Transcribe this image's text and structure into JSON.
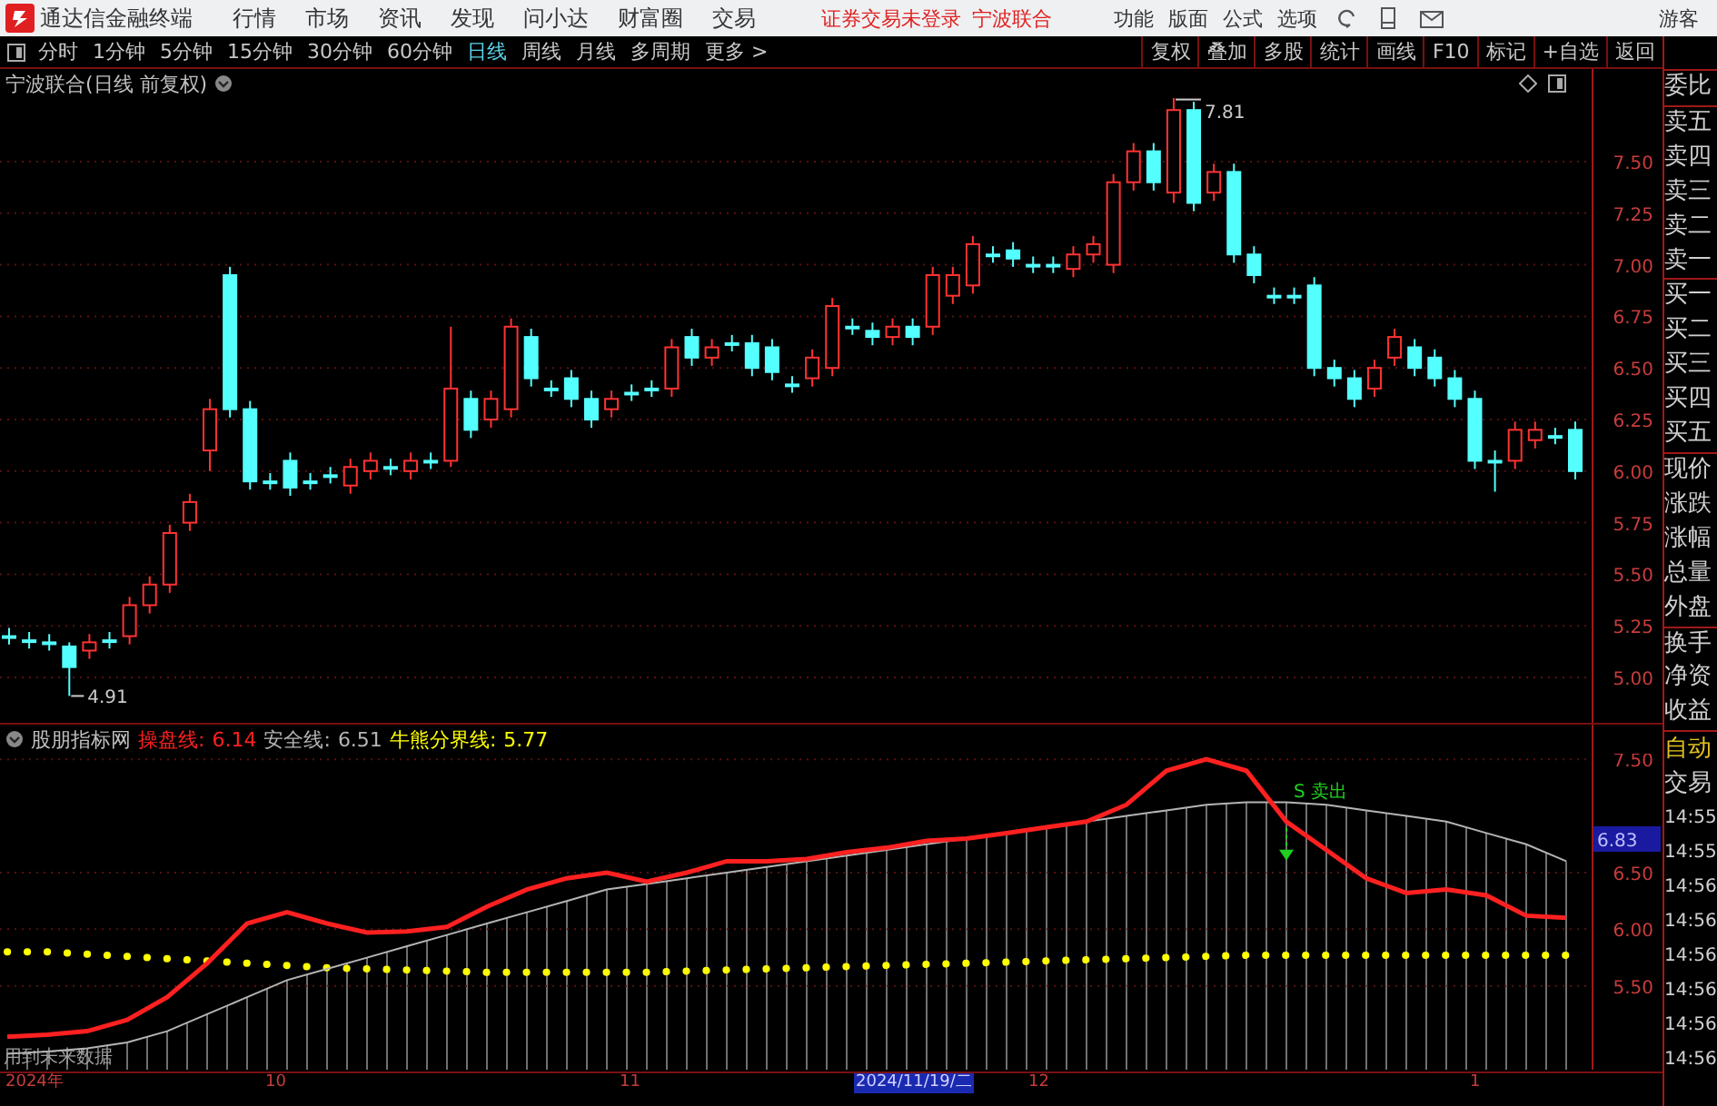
{
  "menubar": {
    "app_name": "通达信金融终端",
    "menus": [
      "行情",
      "市场",
      "资讯",
      "发现",
      "问小达",
      "财富圈",
      "交易"
    ],
    "notices": [
      "证券交易未登录",
      "宁波联合"
    ],
    "right_menus": [
      "功能",
      "版面",
      "公式",
      "选项"
    ],
    "user": "游客"
  },
  "toolbar": {
    "periods": [
      {
        "label": "分时",
        "selected": false
      },
      {
        "label": "1分钟",
        "selected": false
      },
      {
        "label": "5分钟",
        "selected": false
      },
      {
        "label": "15分钟",
        "selected": false
      },
      {
        "label": "30分钟",
        "selected": false
      },
      {
        "label": "60分钟",
        "selected": false
      },
      {
        "label": "日线",
        "selected": true
      },
      {
        "label": "周线",
        "selected": false
      },
      {
        "label": "月线",
        "selected": false
      },
      {
        "label": "多周期",
        "selected": false
      },
      {
        "label": "更多 >",
        "selected": false
      }
    ],
    "buttons": [
      "复权",
      "叠加",
      "多股",
      "统计",
      "画线",
      "F10",
      "标记",
      "+自选",
      "返回"
    ]
  },
  "main_chart": {
    "title": "宁波联合(日线 前复权)",
    "high_label": "7.81",
    "low_label": "4.91",
    "y_axis": [
      "7.50",
      "7.25",
      "7.00",
      "6.75",
      "6.50",
      "6.25",
      "6.00",
      "5.75",
      "5.50",
      "5.25",
      "5.00"
    ]
  },
  "indicator": {
    "name": "股朋指标网",
    "legend_values": [
      "6.14",
      "6.51",
      "5.77"
    ],
    "current_value": "6.83",
    "warning": "用到未来数据",
    "chart_data": {
      "type": "line",
      "grid": true,
      "ylim": [
        4.76,
        7.55
      ],
      "yticks": [
        {
          "value": 7.5,
          "label": "7.50"
        },
        {
          "value": 6.5,
          "label": "6.50"
        },
        {
          "value": 6.0,
          "label": "6.00"
        },
        {
          "value": 5.5,
          "label": "5.50"
        }
      ],
      "series": [
        {
          "name": "操盘线:",
          "color": "#ff2020",
          "values": [
            5.05,
            5.07,
            5.1,
            5.2,
            5.4,
            5.7,
            6.05,
            6.15,
            6.05,
            5.97,
            5.98,
            6.02,
            6.2,
            6.35,
            6.45,
            6.5,
            6.42,
            6.5,
            6.6,
            6.6,
            6.62,
            6.68,
            6.72,
            6.78,
            6.8,
            6.85,
            6.9,
            6.95,
            7.1,
            7.4,
            7.5,
            7.4,
            6.95,
            6.7,
            6.45,
            6.32,
            6.35,
            6.3,
            6.12,
            6.1
          ]
        },
        {
          "name": "安全线:",
          "color": "#b4b4b4",
          "values": [
            4.9,
            4.92,
            4.95,
            5.0,
            5.1,
            5.25,
            5.4,
            5.55,
            5.65,
            5.75,
            5.85,
            5.95,
            6.05,
            6.15,
            6.25,
            6.35,
            6.4,
            6.45,
            6.5,
            6.55,
            6.6,
            6.65,
            6.7,
            6.75,
            6.8,
            6.85,
            6.9,
            6.95,
            7.0,
            7.05,
            7.1,
            7.12,
            7.12,
            7.1,
            7.05,
            7.0,
            6.95,
            6.85,
            6.75,
            6.6
          ]
        },
        {
          "name": "牛熊分界线:",
          "color": "#ffff00",
          "line_style": "dotted",
          "values": [
            5.8,
            5.8,
            5.78,
            5.76,
            5.74,
            5.72,
            5.7,
            5.68,
            5.66,
            5.65,
            5.64,
            5.63,
            5.62,
            5.62,
            5.62,
            5.62,
            5.62,
            5.63,
            5.64,
            5.65,
            5.66,
            5.67,
            5.68,
            5.69,
            5.7,
            5.71,
            5.72,
            5.73,
            5.74,
            5.75,
            5.76,
            5.77,
            5.77,
            5.77,
            5.77,
            5.77,
            5.77,
            5.77,
            5.77,
            5.77
          ]
        }
      ],
      "annotations": [
        "S 卖出"
      ]
    }
  },
  "date_axis": [
    {
      "label": "2024年",
      "selected": false
    },
    {
      "label": "10",
      "selected": false
    },
    {
      "label": "11",
      "selected": false
    },
    {
      "label": "2024/11/19/二",
      "selected": true
    },
    {
      "label": "12",
      "selected": false
    },
    {
      "label": "1",
      "selected": false
    }
  ],
  "side_panel": {
    "groups": [
      [
        "委比"
      ],
      [
        "卖五",
        "卖四",
        "卖三",
        "卖二",
        "卖一"
      ],
      [
        "买一",
        "买二",
        "买三",
        "买四",
        "买五"
      ],
      [
        "现价",
        "涨跌",
        "涨幅",
        "总量",
        "外盘"
      ],
      [
        "换手",
        "净资",
        "收益"
      ]
    ],
    "trade_tabs": [
      {
        "label": "自动",
        "selected": true
      },
      {
        "label": "交易",
        "selected": false
      }
    ],
    "times": [
      "14:55",
      "14:55",
      "14:56",
      "14:56",
      "14:56",
      "14:56",
      "14:56",
      "14:56"
    ]
  }
}
